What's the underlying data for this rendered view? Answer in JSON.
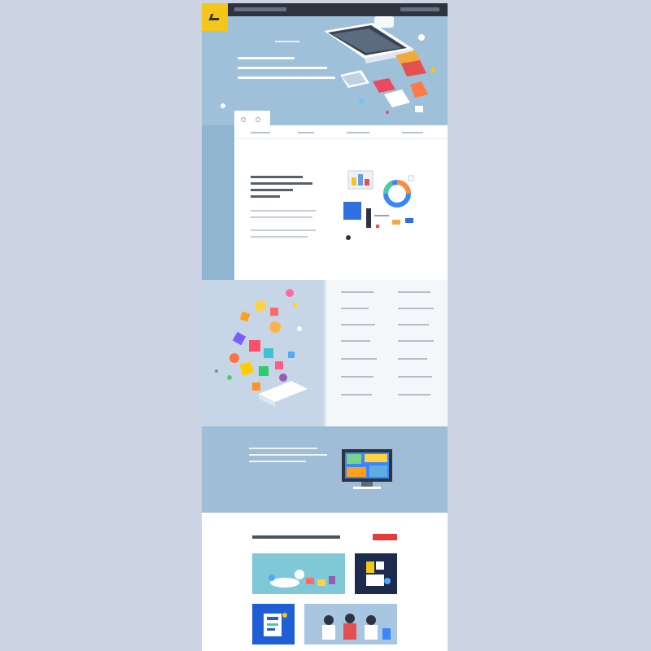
{
  "topbar": {
    "logo": "logo"
  },
  "hero": {
    "headline": ""
  },
  "card": {
    "nav": [
      "",
      "",
      "",
      ""
    ]
  },
  "features": {
    "items": 12
  },
  "portfolio": {
    "view_all": ""
  },
  "colors": {
    "background": "#ccd3e2",
    "topbar": "#2d333f",
    "logo": "#f4c61b",
    "hero": "#9ec0d8",
    "cta": "#9fbdd6",
    "accent_red": "#e43b3b",
    "navy_tile": "#1d2b4f",
    "blue_tile": "#1e5fd6"
  }
}
